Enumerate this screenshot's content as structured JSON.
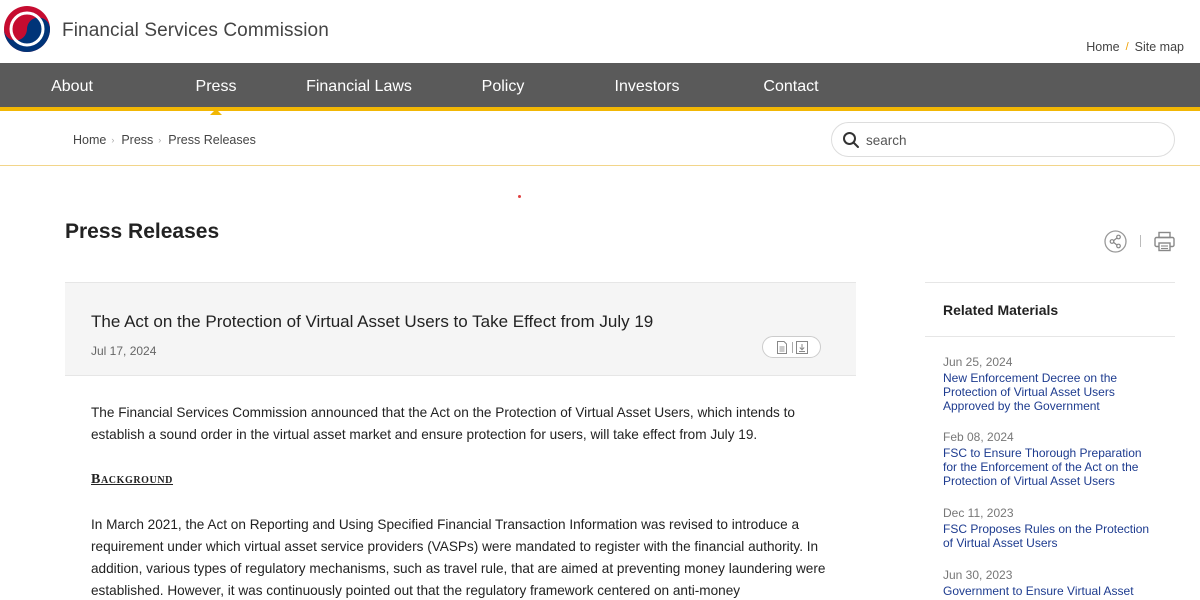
{
  "header": {
    "brand": "Financial Services Commission",
    "utility": {
      "home": "Home",
      "sitemap": "Site map"
    }
  },
  "nav": {
    "items": [
      {
        "label": "About"
      },
      {
        "label": "Press"
      },
      {
        "label": "Financial Laws"
      },
      {
        "label": "Policy"
      },
      {
        "label": "Investors"
      },
      {
        "label": "Contact"
      }
    ],
    "active": "Press"
  },
  "breadcrumb": [
    "Home",
    "Press",
    "Press Releases"
  ],
  "search": {
    "placeholder": "search"
  },
  "page": {
    "title": "Press Releases"
  },
  "article": {
    "title": "The Act on the Protection of Virtual Asset Users to Take Effect from July 19",
    "date": "Jul 17, 2024",
    "paragraphs": [
      "The Financial Services Commission announced that the Act on the Protection of Virtual Asset Users, which intends to establish a sound order in the virtual asset market and ensure protection for users, will take effect from July 19.",
      "In March 2021, the Act on Reporting and Using Specified Financial Transaction Information was revised to introduce a requirement under which virtual asset service providers (VASPs) were mandated to register with the financial authority. In addition, various types of regulatory mechanisms, such as travel rule, that are aimed at preventing money laundering were established. However, it was continuously pointed out that the regulatory framework centered on anti-money"
    ],
    "section_heading": "Background"
  },
  "sidebar": {
    "title": "Related Materials",
    "items": [
      {
        "date": "Jun 25, 2024",
        "title": "New Enforcement Decree on the Protection of Virtual Asset Users Approved by the Government"
      },
      {
        "date": "Feb 08, 2024",
        "title": "FSC to Ensure Thorough Preparation for the Enforcement of the Act on the Protection of Virtual Asset Users"
      },
      {
        "date": "Dec 11, 2023",
        "title": "FSC Proposes Rules on the Protection of Virtual Asset Users"
      },
      {
        "date": "Jun 30, 2023",
        "title": "Government to Ensure Virtual Asset Users Protection Framework"
      }
    ]
  },
  "colors": {
    "nav_bg": "#5a5a5a",
    "accent": "#f2b705",
    "link": "#1d3b8f"
  },
  "icons": [
    "government-emblem-logo",
    "search-icon",
    "share-icon",
    "print-icon",
    "document-icon",
    "download-icon"
  ]
}
